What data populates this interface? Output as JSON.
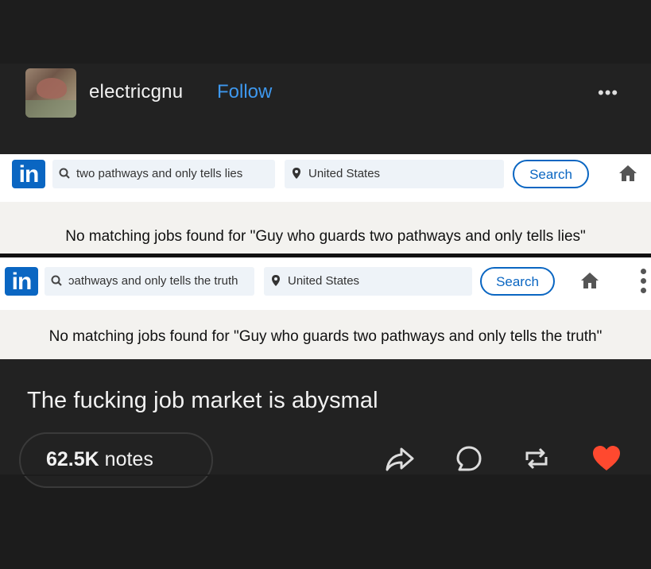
{
  "post": {
    "username": "electricgnu",
    "follow_label": "Follow",
    "more_label": "•••",
    "caption": "The fucking job market is abysmal",
    "notes_count": "62.5K",
    "notes_word": "notes",
    "accent_color": "#3e98ee",
    "like_color": "#ff492f",
    "icons": [
      "share-icon",
      "reply-icon",
      "reblog-icon",
      "heart-icon"
    ]
  },
  "screenshot_1": {
    "logo": "in",
    "search_query": "two pathways and only tells lies",
    "location": "United States",
    "search_button": "Search",
    "message": "No matching jobs found for \"Guy who guards two pathways and only tells lies\""
  },
  "screenshot_2": {
    "logo": "in",
    "search_query": "ɔathways and only tells the truth",
    "location": "United States",
    "search_button": "Search",
    "message": "No matching jobs found for \"Guy who guards two pathways and only tells the truth\""
  }
}
